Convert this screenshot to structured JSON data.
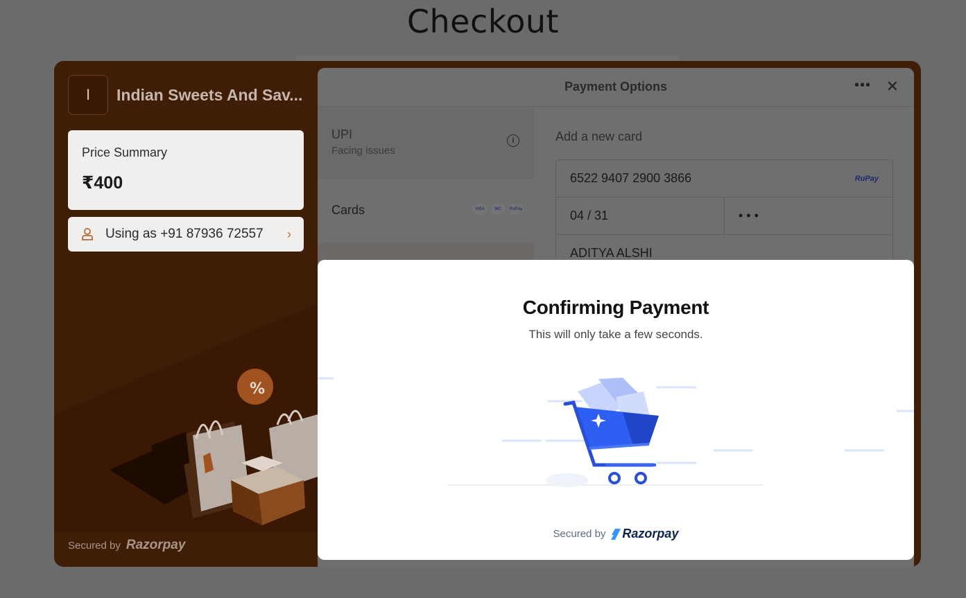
{
  "page": {
    "title": "Checkout"
  },
  "merchant": {
    "logo_initial": "I",
    "name": "Indian Sweets And Sav...",
    "price_label": "Price Summary",
    "price_value": "₹400",
    "user_text": "Using as +91 87936 72557",
    "secured_text": "Secured by",
    "secured_brand": "Razorpay"
  },
  "payment": {
    "header_title": "Payment Options",
    "methods": [
      {
        "name": "UPI",
        "sub": "Facing issues"
      },
      {
        "name": "Cards",
        "logos": [
          "VISA",
          "MC",
          "RuPay"
        ]
      }
    ],
    "card_form": {
      "heading": "Add a new card",
      "card_number": "6522 9407 2900 3866",
      "network": "RuPay",
      "expiry": "04 / 31",
      "cvv": "• • •",
      "name": "ADITYA ALSHI"
    }
  },
  "modal": {
    "title": "Confirming Payment",
    "subtitle": "This will only take a few seconds.",
    "secured_text": "Secured by",
    "secured_brand": "Razorpay"
  },
  "colors": {
    "overlay_gray": "#6b6b6b",
    "merchant_brown": "#3f1d06",
    "cart_blue": "#2f5ff2",
    "brand_navy": "#0c2451"
  }
}
